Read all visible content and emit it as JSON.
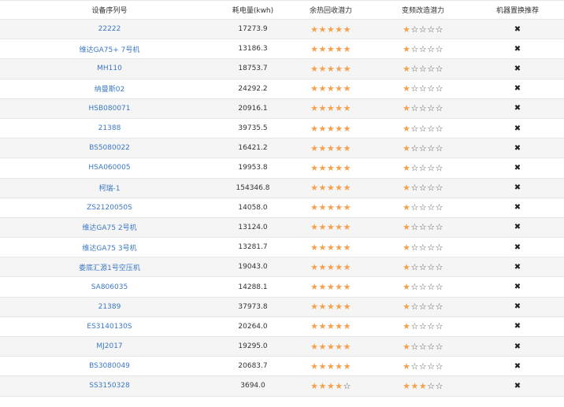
{
  "headers": {
    "serial": "设备序列号",
    "power": "耗电量(kwh)",
    "heat_recovery": "余热回收潜力",
    "vfd_retrofit": "变频改造潜力",
    "replacement": "机器置换推荐"
  },
  "icons": {
    "star_full": "★",
    "star_empty": "☆",
    "replace": "✖"
  },
  "colors": {
    "link": "#3c78c3",
    "star": "#f6a04d",
    "stripe": "#f5f5f5"
  },
  "rows": [
    {
      "serial": "22222",
      "power": "17273.9",
      "heat": 5,
      "vfd": 1
    },
    {
      "serial": "维达GA75+ 7号机",
      "power": "13186.3",
      "heat": 5,
      "vfd": 1
    },
    {
      "serial": "MH110",
      "power": "18753.7",
      "heat": 5,
      "vfd": 1
    },
    {
      "serial": "纳曼斯02",
      "power": "24292.2",
      "heat": 5,
      "vfd": 1
    },
    {
      "serial": "HSB080071",
      "power": "20916.1",
      "heat": 5,
      "vfd": 1
    },
    {
      "serial": "21388",
      "power": "39735.5",
      "heat": 5,
      "vfd": 1
    },
    {
      "serial": "BS5080022",
      "power": "16421.2",
      "heat": 5,
      "vfd": 1
    },
    {
      "serial": "HSA060005",
      "power": "19953.8",
      "heat": 5,
      "vfd": 1
    },
    {
      "serial": "柯瑞-1",
      "power": "154346.8",
      "heat": 5,
      "vfd": 1
    },
    {
      "serial": "ZS2120050S",
      "power": "14058.0",
      "heat": 5,
      "vfd": 1
    },
    {
      "serial": "维达GA75 2号机",
      "power": "13124.0",
      "heat": 5,
      "vfd": 1
    },
    {
      "serial": "维达GA75 3号机",
      "power": "13281.7",
      "heat": 5,
      "vfd": 1
    },
    {
      "serial": "娄底汇源1号空压机",
      "power": "19043.0",
      "heat": 5,
      "vfd": 1
    },
    {
      "serial": "SA806035",
      "power": "14288.1",
      "heat": 5,
      "vfd": 1
    },
    {
      "serial": "21389",
      "power": "37973.8",
      "heat": 5,
      "vfd": 1
    },
    {
      "serial": "ES3140130S",
      "power": "20264.0",
      "heat": 5,
      "vfd": 1
    },
    {
      "serial": "MJ2017",
      "power": "19295.0",
      "heat": 5,
      "vfd": 1
    },
    {
      "serial": "BS3080049",
      "power": "20683.7",
      "heat": 5,
      "vfd": 1
    },
    {
      "serial": "SS3150328",
      "power": "3694.0",
      "heat": 4,
      "vfd": 3
    }
  ]
}
